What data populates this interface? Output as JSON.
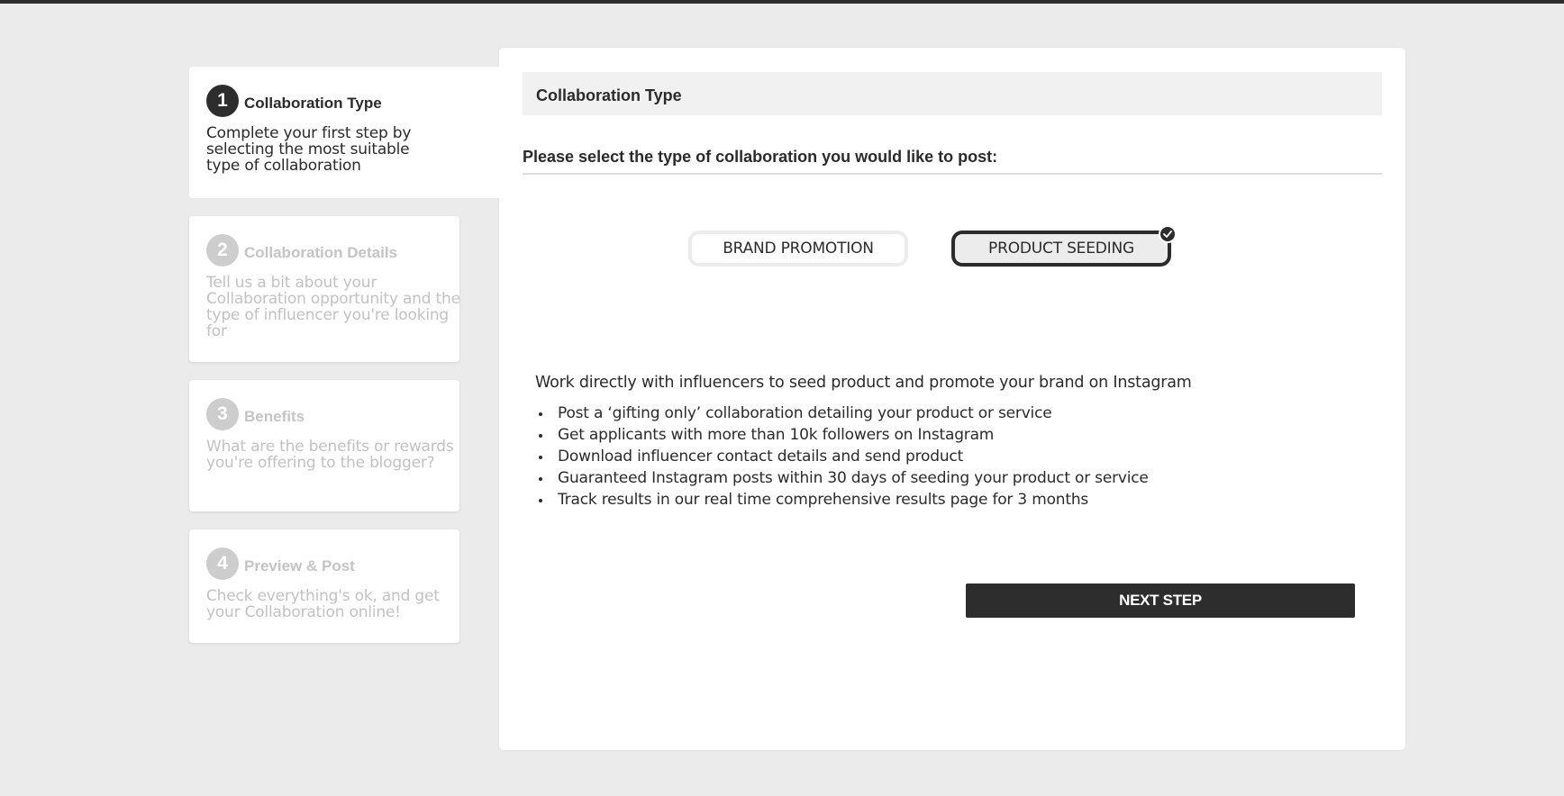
{
  "steps": [
    {
      "number": "1",
      "title": "Collaboration Type",
      "description": "Complete your first step by selecting the most suitable type of collaboration",
      "active": true
    },
    {
      "number": "2",
      "title": "Collaboration Details",
      "description": "Tell us a bit about your Collaboration opportunity and the type of influencer you're looking for",
      "active": false
    },
    {
      "number": "3",
      "title": "Benefits",
      "description": "What are the benefits or rewards you're offering to the blogger?",
      "active": false
    },
    {
      "number": "4",
      "title": "Preview & Post",
      "description": "Check everything's ok, and get your Collaboration online!",
      "active": false
    }
  ],
  "panel": {
    "header": "Collaboration Type",
    "prompt": "Please select the type of collaboration you would like to post:",
    "options": {
      "brand_promotion": "BRAND PROMOTION",
      "product_seeding": "PRODUCT SEEDING",
      "selected": "product_seeding"
    },
    "intro": "Work directly with influencers to seed product and promote your brand on Instagram",
    "features": [
      "Post a ‘gifting only’ collaboration detailing your product or service",
      "Get applicants with more than 10k followers on Instagram",
      "Download influencer contact details and send product",
      "Guaranteed Instagram posts within 30 days of seeding your product or service",
      "Track results in our real time comprehensive results page for 3 months"
    ],
    "next_button": "NEXT STEP"
  },
  "icons": {
    "selected_badge": "check-icon"
  },
  "colors": {
    "accent": "#2d2d2d",
    "background": "#ebebeb",
    "inactive_text": "#c2c2c2"
  }
}
